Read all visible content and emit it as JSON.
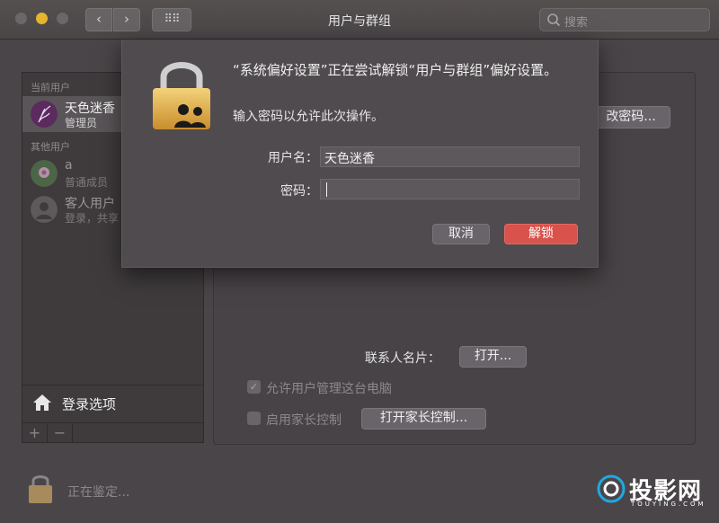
{
  "window": {
    "title": "用户与群组",
    "nav_back": "‹",
    "nav_forward": "›",
    "grid": "⠿⠿",
    "search_placeholder": "搜索"
  },
  "sidebar": {
    "current_users_heading": "当前用户",
    "other_users_heading": "其他用户",
    "users": [
      {
        "name": "天色迷香",
        "role": "管理员",
        "avatar": "feather-avatar"
      },
      {
        "name": "a",
        "role": "普通成员",
        "avatar": "flower-avatar"
      },
      {
        "name": "客人用户",
        "role": "登录，共享",
        "avatar": "guest-avatar"
      }
    ],
    "login_options_label": "登录选项",
    "add_label": "+",
    "remove_label": "−"
  },
  "main": {
    "change_password_label": "改密码...",
    "contact_card_label": "联系人名片：",
    "open_label": "打开...",
    "allow_admin_label": "允许用户管理这台电脑",
    "allow_admin_checked": true,
    "parental_controls_label": "启用家长控制",
    "parental_controls_checked": false,
    "open_parental_label": "打开家长控制..."
  },
  "status": {
    "text": "正在鉴定..."
  },
  "watermark": {
    "text": "投影网",
    "sub": "TOUYING.COM"
  },
  "auth_dialog": {
    "title": "“系统偏好设置”正在尝试解锁“用户与群组”偏好设置。",
    "subtitle": "输入密码以允许此次操作。",
    "username_label": "用户名：",
    "username_value": "天色迷香",
    "password_label": "密码：",
    "password_value": "",
    "cancel_label": "取消",
    "unlock_label": "解锁",
    "accent_color": "#d9524c"
  }
}
